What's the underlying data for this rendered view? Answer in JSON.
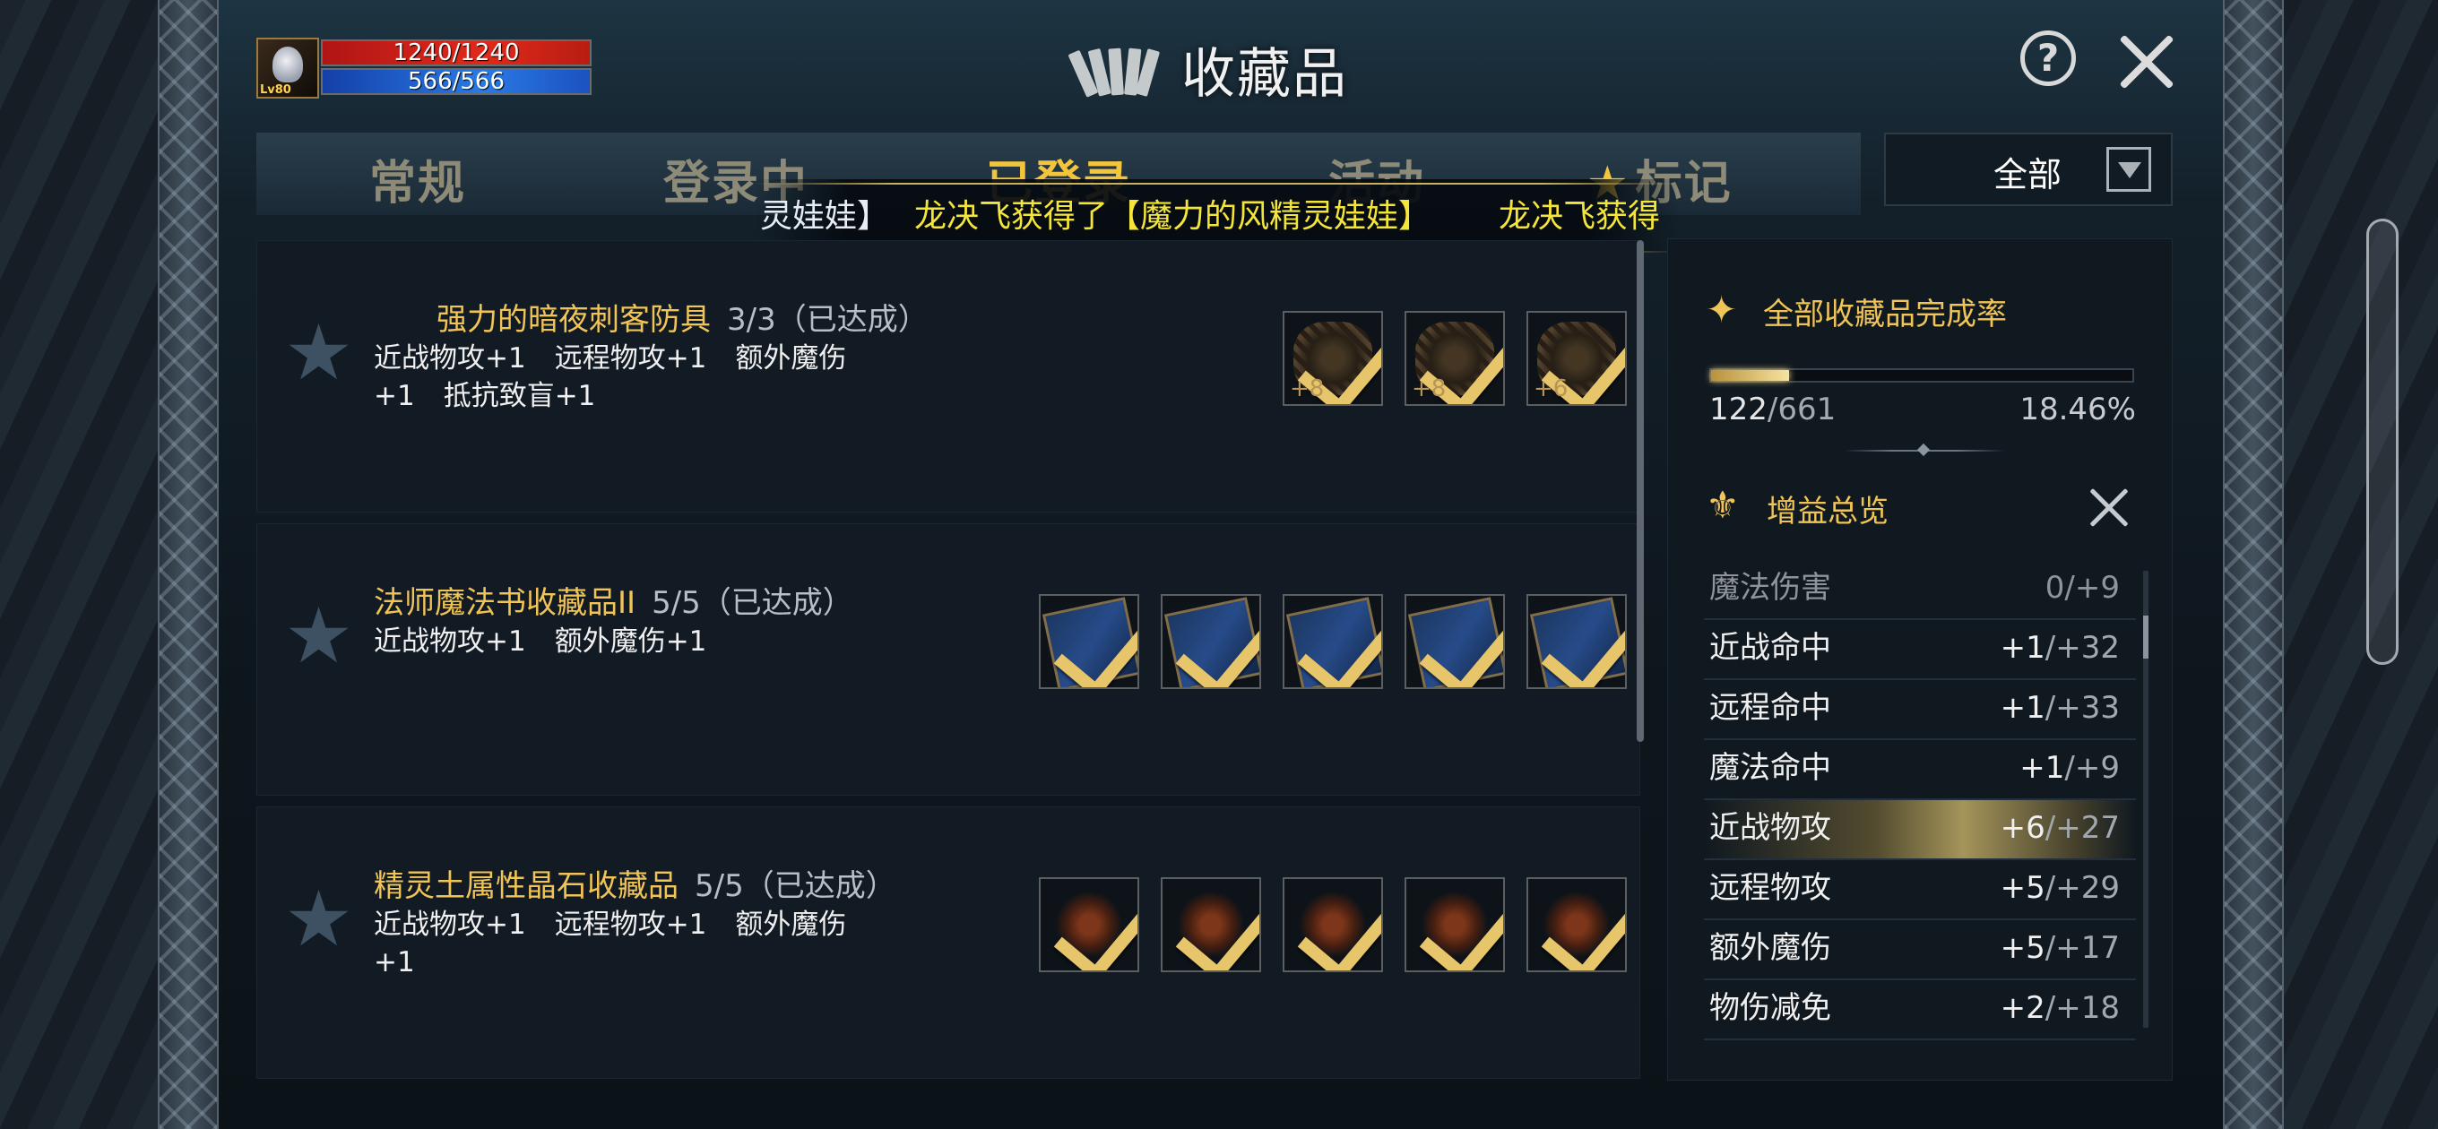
{
  "character": {
    "hp": "1240/1240",
    "mp": "566/566",
    "level": "Lv80"
  },
  "header": {
    "title": "收藏品"
  },
  "tabs": [
    {
      "label": "常规"
    },
    {
      "label": "登录中"
    },
    {
      "label": "已登录"
    },
    {
      "label": "活动"
    },
    {
      "label": "标记"
    }
  ],
  "filter": {
    "selected": "全部"
  },
  "ticker": {
    "part1": "灵娃娃】",
    "part2": "龙决飞获得了【魔力的风精灵娃娃】",
    "part3": "龙决飞获得"
  },
  "collections": [
    {
      "title": "强力的暗夜刺客防具",
      "progress": "3/3（已达成）",
      "effects": [
        "近战物攻+1",
        "远程物攻+1",
        "额外魔伤+1",
        "抵抗致盲+1"
      ],
      "items": [
        {
          "art": "chain",
          "enhance": "+8"
        },
        {
          "art": "chain",
          "enhance": "+8"
        },
        {
          "art": "chain",
          "enhance": "+6"
        }
      ]
    },
    {
      "title": "法师魔法书收藏品II",
      "progress": "5/5（已达成）",
      "effects": [
        "近战物攻+1",
        "额外魔伤+1"
      ],
      "items": [
        {
          "art": "book",
          "enhance": ""
        },
        {
          "art": "book",
          "enhance": ""
        },
        {
          "art": "book",
          "enhance": ""
        },
        {
          "art": "book",
          "enhance": ""
        },
        {
          "art": "book",
          "enhance": ""
        }
      ]
    },
    {
      "title": "精灵土属性晶石收藏品",
      "progress": "5/5（已达成）",
      "effects": [
        "近战物攻+1",
        "远程物攻+1",
        "额外魔伤+1"
      ],
      "items": [
        {
          "art": "crystal",
          "enhance": ""
        },
        {
          "art": "crystal",
          "enhance": ""
        },
        {
          "art": "crystal",
          "enhance": ""
        },
        {
          "art": "crystal",
          "enhance": ""
        },
        {
          "art": "crystal",
          "enhance": ""
        }
      ]
    }
  ],
  "completion": {
    "title": "全部收藏品完成率",
    "count": "122",
    "total": "/661",
    "percent": "18.46%",
    "fraction": 0.1846
  },
  "buffs": {
    "title": "增益总览",
    "rows": [
      {
        "name": "魔法伤害",
        "value": "0",
        "max": "/+9",
        "state": "dim"
      },
      {
        "name": "近战命中",
        "value": "+1",
        "max": "/+32",
        "state": ""
      },
      {
        "name": "远程命中",
        "value": "+1",
        "max": "/+33",
        "state": ""
      },
      {
        "name": "魔法命中",
        "value": "+1",
        "max": "/+9",
        "state": ""
      },
      {
        "name": "近战物攻",
        "value": "+6",
        "max": "/+27",
        "state": "hl"
      },
      {
        "name": "远程物攻",
        "value": "+5",
        "max": "/+29",
        "state": ""
      },
      {
        "name": "额外魔伤",
        "value": "+5",
        "max": "/+17",
        "state": ""
      },
      {
        "name": "物伤减免",
        "value": "+2",
        "max": "/+18",
        "state": ""
      }
    ]
  },
  "colors": {
    "gold": "#f0c457",
    "tab_active": "#f2c53d",
    "tab_inactive": "#8d8a78",
    "ticker_yellow": "#f4e53a"
  }
}
